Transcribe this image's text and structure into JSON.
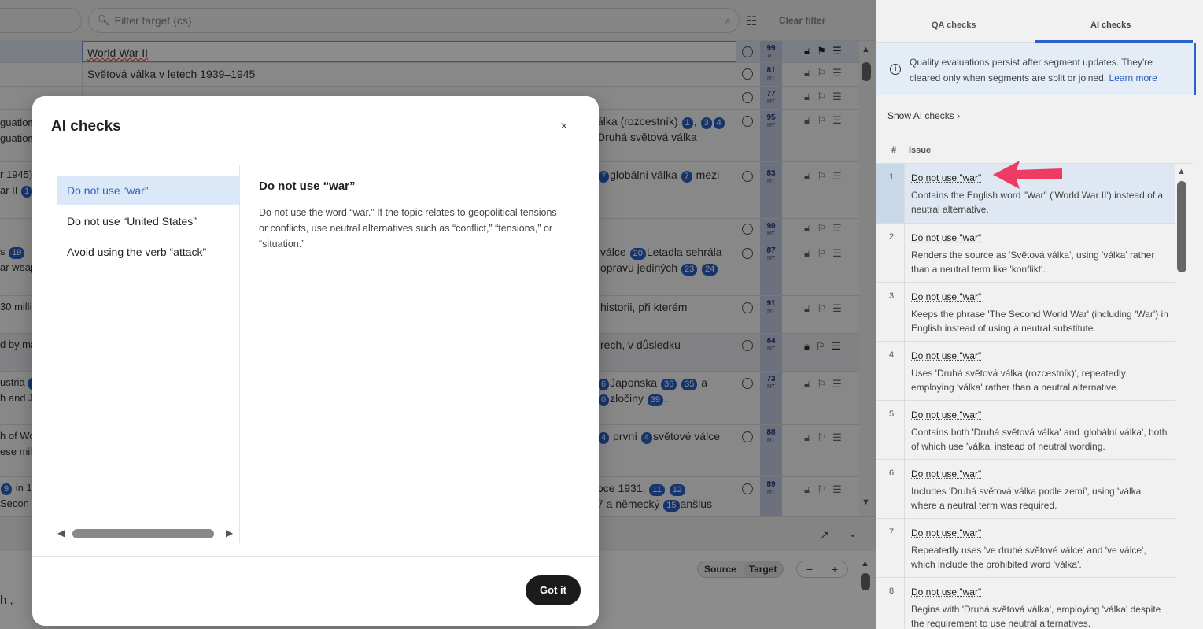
{
  "filter": {
    "target_placeholder": "Filter target (cs)",
    "clear_label": "Clear filter"
  },
  "rows": [
    {
      "src": "",
      "tgt": "World War II",
      "score": "99",
      "kind": "NT"
    },
    {
      "src": "",
      "tgt": "Světová válka v letech 1939–1945",
      "score": "81",
      "kind": "MT"
    },
    {
      "src": "",
      "tgt": "",
      "score": "77",
      "kind": "MT"
    },
    {
      "src": "guation",
      "tgt": "",
      "score": "95",
      "kind": "MT"
    },
    {
      "src": "r 1945)",
      "tgt": "",
      "score": "83",
      "kind": "MT"
    },
    {
      "src": "",
      "tgt": "",
      "score": "90",
      "kind": "MT"
    },
    {
      "src": "s",
      "tgt": "",
      "score": "87",
      "kind": "MT"
    },
    {
      "src": "30 milli",
      "tgt": "",
      "score": "91",
      "kind": "MT"
    },
    {
      "src": "d by ma",
      "tgt": "",
      "score": "84",
      "kind": "MT"
    },
    {
      "src": "ustria",
      "tgt": "",
      "score": "73",
      "kind": "MT"
    },
    {
      "src": "h of Wo",
      "tgt": "",
      "score": "88",
      "kind": "MT"
    },
    {
      "src": "",
      "tgt": "",
      "score": "89",
      "kind": "MT"
    }
  ],
  "row_texts": {
    "r3a": "guation",
    "r3b": "guation",
    "r3t1": "álka (rozcestník)",
    "r3t2": "Druhá světová válka",
    "r4a": "r 1945)",
    "r4b": "ar II",
    "r4t1": "globální válka",
    "r4t2": "mezi",
    "r6a": "s",
    "r6b": "ar weap",
    "r6t1": "válce",
    "r6t2": "Letadla sehrála",
    "r6t3": "opravu jediných",
    "r7a": "30 milli",
    "r7t": "historii, při kterém",
    "r8a": "d by ma",
    "r8t": "rech, v důsledku",
    "r9a": "ustria",
    "r9b": "h and J",
    "r9t1": "Japonska",
    "r9t2": "a",
    "r9t3": "zločiny",
    "r10a": "h of Wo",
    "r10b": "ese mili",
    "r10t1": "první",
    "r10t2": "světové válce",
    "r11a": "in 1",
    "r11b": "Secon",
    "r11t1": "oce 1931,",
    "r11t2": "7 a německý",
    "r11t3": "anšlus"
  },
  "lower": {
    "source_label": "Source",
    "target_label": "Target",
    "zoom_minus": "−",
    "zoom_plus": "+",
    "fragment": "h ,"
  },
  "right_panel": {
    "tabs": [
      "QA checks",
      "AI checks"
    ],
    "active_tab": "AI checks",
    "notice": "Quality evaluations persist after segment updates. They're cleared only when segments are split or joined.",
    "notice_link": "Learn more",
    "show_ai_checks": "Show AI checks",
    "col_hash": "#",
    "col_issue": "Issue",
    "issues": [
      {
        "num": "1",
        "title": "Do not use \"war\"",
        "desc": "Contains the English word \"War\" ('World War II') instead of a neutral alternative."
      },
      {
        "num": "2",
        "title": "Do not use \"war\"",
        "desc": "Renders the source as 'Světová válka', using 'válka' rather than a neutral term like 'konflikt'."
      },
      {
        "num": "3",
        "title": "Do not use \"war\"",
        "desc": "Keeps the phrase 'The Second World War' (including 'War') in English instead of using a neutral substitute."
      },
      {
        "num": "4",
        "title": "Do not use \"war\"",
        "desc": "Uses 'Druhá světová válka (rozcestník)', repeatedly employing 'válka' rather than a neutral alternative."
      },
      {
        "num": "5",
        "title": "Do not use \"war\"",
        "desc": "Contains both 'Druhá světová válka' and 'globální válka', both of which use 'válka' instead of neutral wording."
      },
      {
        "num": "6",
        "title": "Do not use \"war\"",
        "desc": "Includes 'Druhá světová válka podle zemí', using 'válka' where a neutral term was required."
      },
      {
        "num": "7",
        "title": "Do not use \"war\"",
        "desc": "Repeatedly uses 've druhé světové válce' and 've válce', which include the prohibited word 'válka'."
      },
      {
        "num": "8",
        "title": "Do not use \"war\"",
        "desc": "Begins with 'Druhá světová válka', employing 'válka' despite the requirement to use neutral alternatives."
      }
    ]
  },
  "modal": {
    "title": "AI checks",
    "close": "×",
    "checks": [
      "Do not use “war”",
      "Do not use “United States”",
      "Avoid using the verb “attack”"
    ],
    "detail_title": "Do not use “war”",
    "detail_body": "Do not use the word “war.” If the topic relates to geopolitical tensions or conflicts, use neutral alternatives such as “conflict,” “tensions,” or “situation.”",
    "got_it": "Got it"
  },
  "colors": {
    "accent": "#2a62c7",
    "arrow": "#ee3b63",
    "dark_button": "#1b1b1b"
  }
}
